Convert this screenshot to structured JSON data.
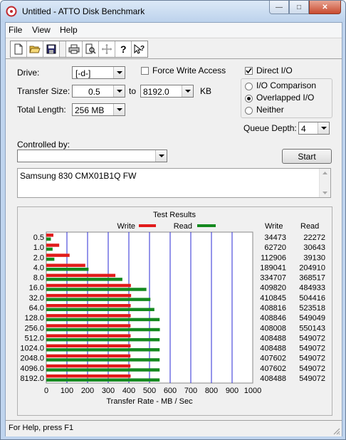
{
  "window": {
    "title": "Untitled - ATTO Disk Benchmark",
    "minimize_glyph": "—",
    "maximize_glyph": "□",
    "close_glyph": "✕"
  },
  "menu": [
    "File",
    "View",
    "Help"
  ],
  "toolbar": {
    "icons": [
      "new-icon",
      "open-icon",
      "save-icon",
      "print-icon",
      "print-preview-icon",
      "move-icon",
      "help-icon",
      "context-help-icon"
    ]
  },
  "settings": {
    "drive_label": "Drive:",
    "drive_value": "[-d-]",
    "force_write_label": "Force Write Access",
    "force_write_checked": false,
    "direct_io_label": "Direct I/O",
    "direct_io_checked": true,
    "transfer_size_label": "Transfer Size:",
    "transfer_from": "0.5",
    "to_label": "to",
    "transfer_to": "8192.0",
    "kb_label": "KB",
    "total_length_label": "Total Length:",
    "total_length_value": "256 MB",
    "io_options": [
      {
        "label": "I/O Comparison",
        "selected": false
      },
      {
        "label": "Overlapped I/O",
        "selected": true
      },
      {
        "label": "Neither",
        "selected": false
      }
    ],
    "queue_depth_label": "Queue Depth:",
    "queue_depth_value": "4",
    "controlled_by_label": "Controlled by:",
    "controlled_by_value": "",
    "start_label": "Start",
    "description": "Samsung 830 CMX01B1Q FW"
  },
  "results": {
    "title": "Test Results",
    "write_legend": "Write",
    "read_legend": "Read",
    "write_col": "Write",
    "read_col": "Read",
    "write_color": "#e11b1b",
    "read_color": "#14891f",
    "grid_color": "#2a2ad4",
    "rows": [
      {
        "size": "0.5",
        "write": "34473",
        "read": "22272"
      },
      {
        "size": "1.0",
        "write": "62720",
        "read": "30643"
      },
      {
        "size": "2.0",
        "write": "112906",
        "read": "39130"
      },
      {
        "size": "4.0",
        "write": "189041",
        "read": "204910"
      },
      {
        "size": "8.0",
        "write": "334707",
        "read": "368517"
      },
      {
        "size": "16.0",
        "write": "409820",
        "read": "484933"
      },
      {
        "size": "32.0",
        "write": "410845",
        "read": "504416"
      },
      {
        "size": "64.0",
        "write": "408816",
        "read": "523518"
      },
      {
        "size": "128.0",
        "write": "408846",
        "read": "549049"
      },
      {
        "size": "256.0",
        "write": "408008",
        "read": "550143"
      },
      {
        "size": "512.0",
        "write": "408488",
        "read": "549072"
      },
      {
        "size": "1024.0",
        "write": "408488",
        "read": "549072"
      },
      {
        "size": "2048.0",
        "write": "407602",
        "read": "549072"
      },
      {
        "size": "4096.0",
        "write": "407602",
        "read": "549072"
      },
      {
        "size": "8192.0",
        "write": "408488",
        "read": "549072"
      }
    ]
  },
  "chart_data": {
    "type": "bar",
    "orientation": "horizontal",
    "categories": [
      "0.5",
      "1.0",
      "2.0",
      "4.0",
      "8.0",
      "16.0",
      "32.0",
      "64.0",
      "128.0",
      "256.0",
      "512.0",
      "1024.0",
      "2048.0",
      "4096.0",
      "8192.0"
    ],
    "series": [
      {
        "name": "Write",
        "values": [
          34473,
          62720,
          112906,
          189041,
          334707,
          409820,
          410845,
          408816,
          408846,
          408008,
          408488,
          408488,
          407602,
          407602,
          408488
        ]
      },
      {
        "name": "Read",
        "values": [
          22272,
          30643,
          39130,
          204910,
          368517,
          484933,
          504416,
          523518,
          549049,
          550143,
          549072,
          549072,
          549072,
          549072,
          549072
        ]
      }
    ],
    "xlim": [
      0,
      1000
    ],
    "x_ticks": [
      "0",
      "100",
      "200",
      "300",
      "400",
      "500",
      "600",
      "700",
      "800",
      "900",
      "1000"
    ],
    "xlabel": "Transfer Rate - MB / Sec",
    "grid": true,
    "legend": "top"
  },
  "status": {
    "text": "For Help, press F1"
  }
}
